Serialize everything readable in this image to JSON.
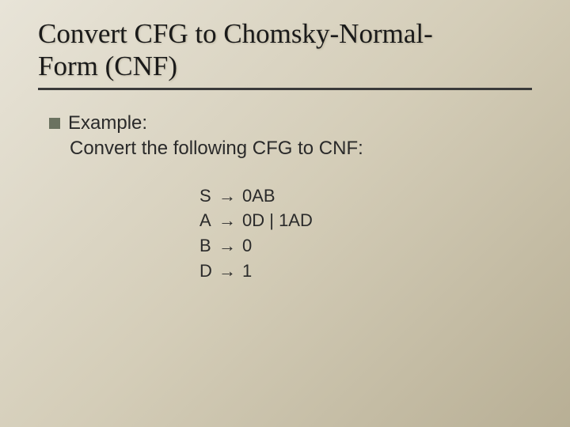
{
  "title_line1": "Convert CFG to Chomsky-Normal-",
  "title_line2": "Form (CNF)",
  "bullet_label": "Example:",
  "subtext": "Convert the following CFG to CNF:",
  "arrow": "→",
  "productions": [
    {
      "lhs": "S",
      "rhs": "0AB"
    },
    {
      "lhs": "A",
      "rhs": "0D | 1AD"
    },
    {
      "lhs": "B",
      "rhs": "0"
    },
    {
      "lhs": "D",
      "rhs": "1"
    }
  ]
}
